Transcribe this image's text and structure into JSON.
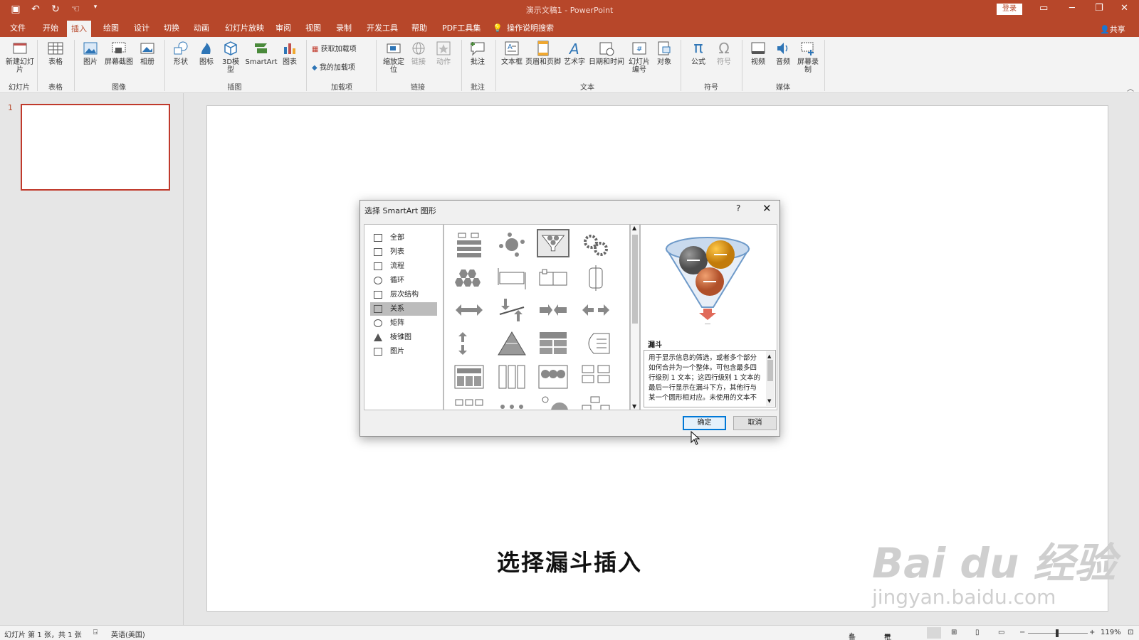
{
  "window": {
    "title": "演示文稿1  -  PowerPoint",
    "login_label": "登录",
    "share_label": "共享"
  },
  "tabs": [
    "文件",
    "开始",
    "插入",
    "绘图",
    "设计",
    "切换",
    "动画",
    "幻灯片放映",
    "审阅",
    "视图",
    "录制",
    "开发工具",
    "帮助",
    "PDF工具集",
    "操作说明搜索"
  ],
  "active_tab": "插入",
  "ribbon": {
    "buttons": {
      "new_slide": "新建幻灯片",
      "table": "表格",
      "picture": "图片",
      "screenshot": "屏幕截图",
      "album": "相册",
      "shapes": "形状",
      "icons": "图标",
      "model3d": "3D模型",
      "smartart": "SmartArt",
      "chart": "图表",
      "get_addins": "获取加载项",
      "my_addins": "我的加载项",
      "zoom": "缩放定位",
      "link": "链接",
      "action": "动作",
      "comment": "批注",
      "textbox": "文本框",
      "header_footer": "页眉和页脚",
      "wordart": "艺术字",
      "datetime": "日期和时间",
      "slide_number": "幻灯片编号",
      "object": "对象",
      "equation": "公式",
      "symbol": "符号",
      "video": "视频",
      "audio": "音频",
      "screen_recording": "屏幕录制"
    },
    "groups": {
      "slides": "幻灯片",
      "tables": "表格",
      "images": "图像",
      "illustrations": "插图",
      "addins": "加载项",
      "links": "链接",
      "comments": "批注",
      "text": "文本",
      "symbols": "符号",
      "media": "媒体"
    }
  },
  "slide_panel": {
    "slide_number": "1"
  },
  "slide": {
    "caption": "选择漏斗插入"
  },
  "watermark": {
    "text": "Bai du 经验",
    "url": "jingyan.baidu.com"
  },
  "dialog": {
    "title": "选择 SmartArt 图形",
    "help": "?",
    "categories": [
      "全部",
      "列表",
      "流程",
      "循环",
      "层次结构",
      "关系",
      "矩阵",
      "棱锥图",
      "图片"
    ],
    "selected_category": "关系",
    "preview": {
      "name": "漏斗",
      "description": "用于显示信息的筛选，或者多个部分如何合并为一个整体。可包含最多四行级别 1 文本；这四行级别 1 文本的最后一行显示在漏斗下方，其他行与某一个圆形相对应。未使用的文本不"
    },
    "ok_label": "确定",
    "cancel_label": "取消"
  },
  "status": {
    "slide_info": "幻灯片 第 1 张，共 1 张",
    "language": "英语(美国)",
    "notes": "备注",
    "comments": "批注",
    "zoom": "119%"
  },
  "colors": {
    "accent": "#b7472a",
    "ribbon_bg": "#f3f3f3",
    "selection_red": "#c0392b",
    "ok_blue": "#0078d7"
  }
}
